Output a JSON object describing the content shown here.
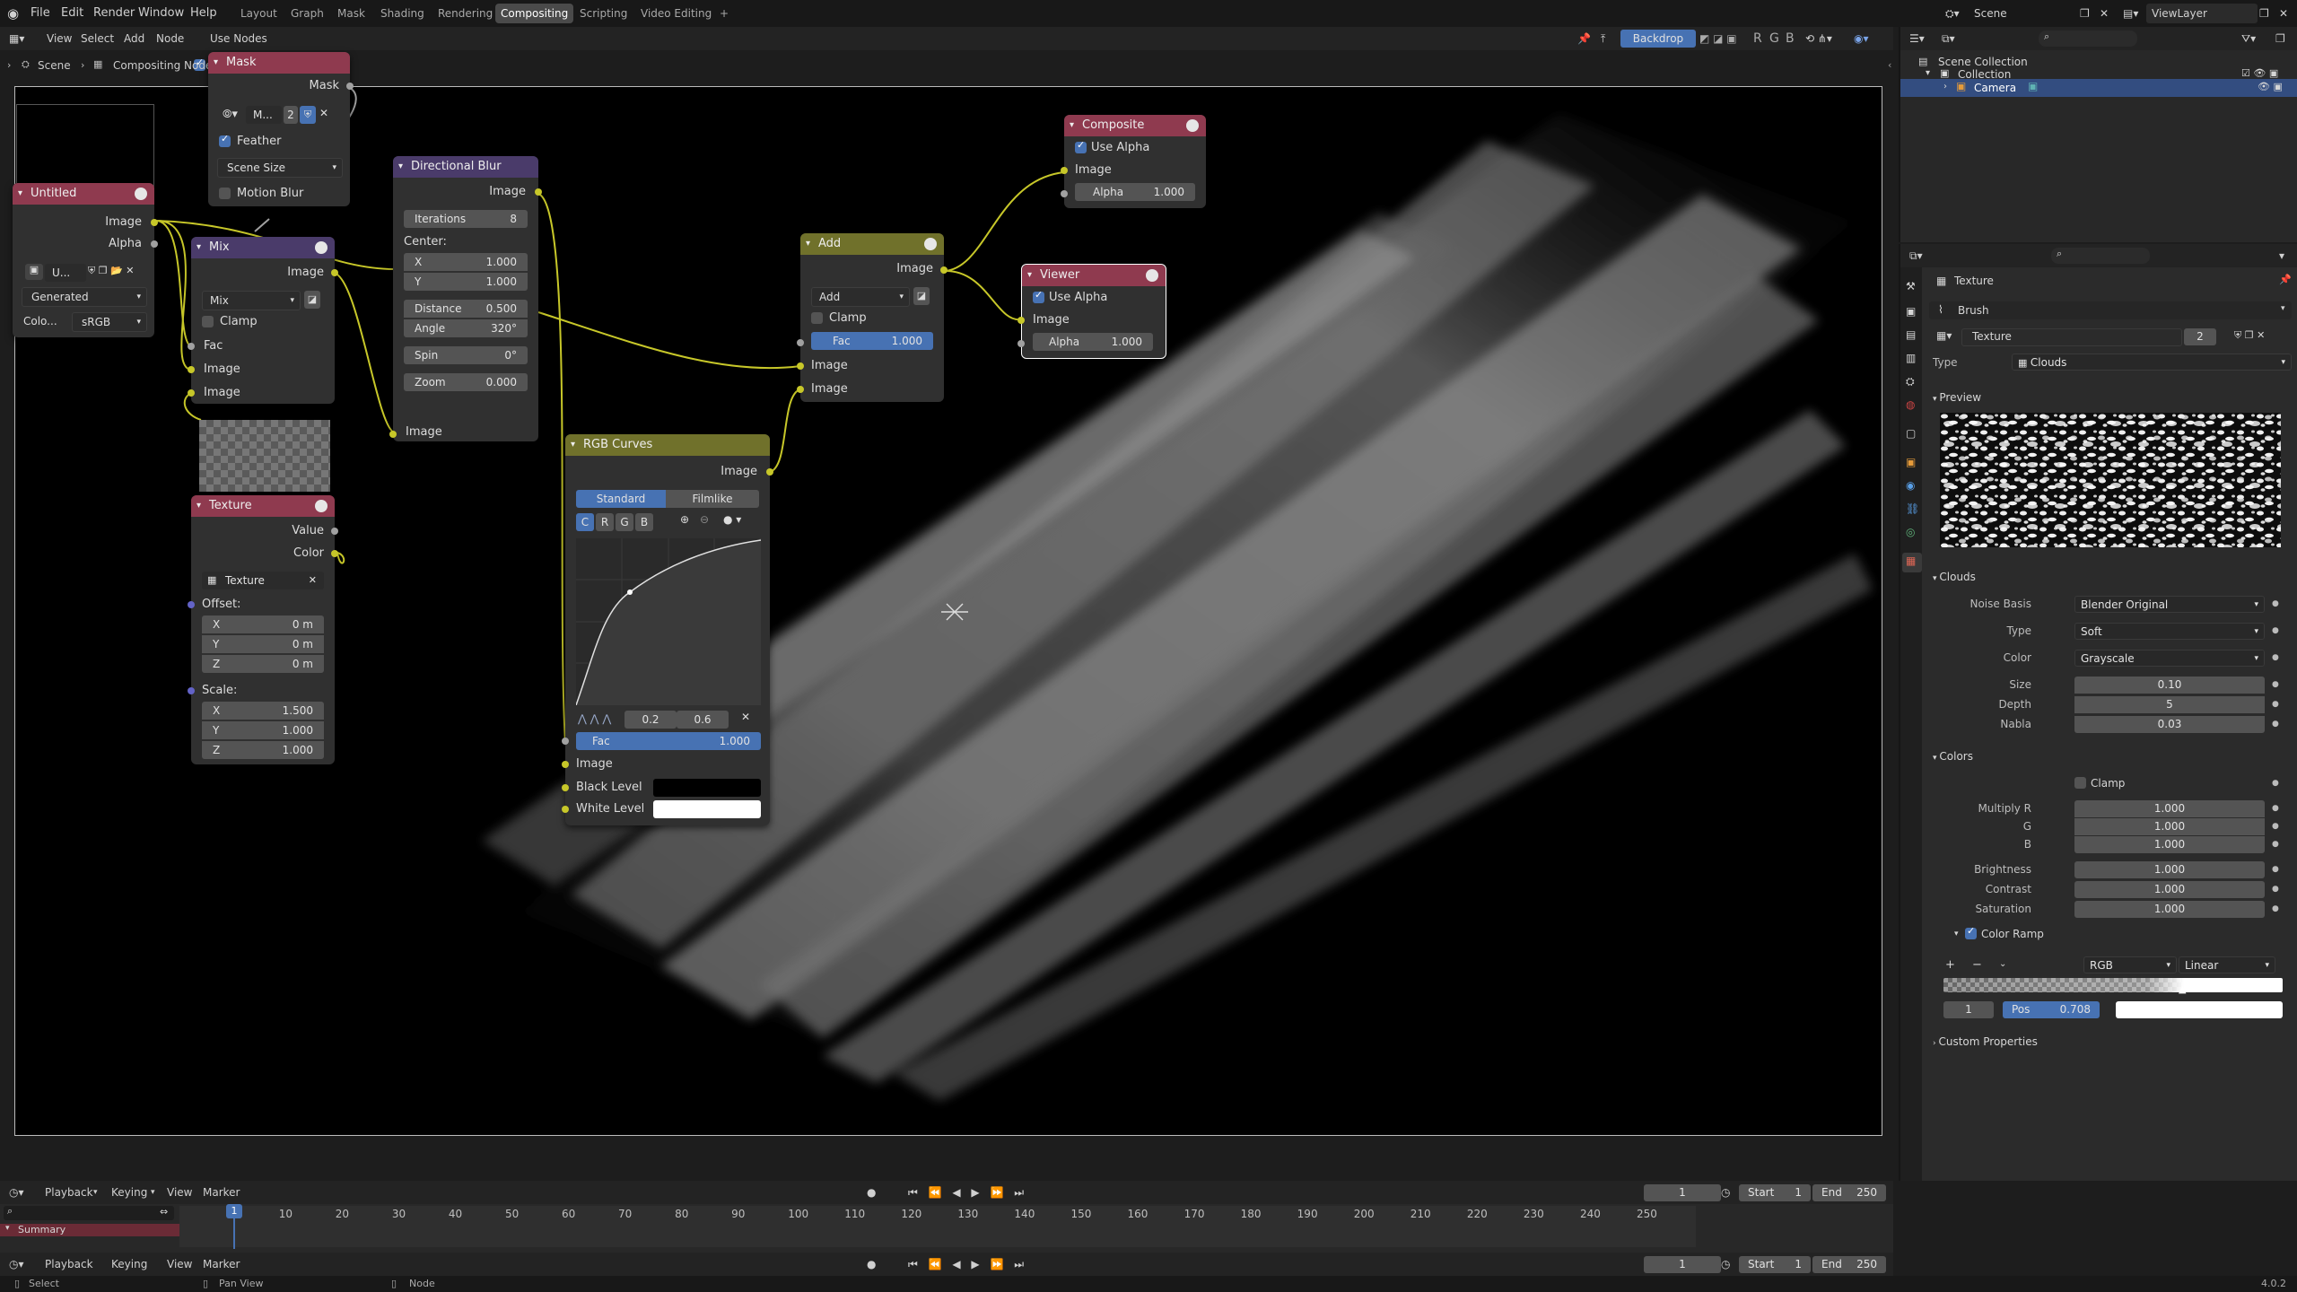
{
  "menu": {
    "items": [
      "File",
      "Edit",
      "Render",
      "Window",
      "Help"
    ],
    "workspaces": [
      "Layout",
      "Graph",
      "Mask",
      "Shading",
      "Rendering",
      "Compositing",
      "Scripting",
      "Video Editing"
    ],
    "add_tab": "+",
    "scene_label": "Scene",
    "view_layer_label": "ViewLayer"
  },
  "editor_header": {
    "menus": [
      "View",
      "Select",
      "Add",
      "Node"
    ],
    "use_nodes_label": "Use Nodes",
    "backdrop_label": "Backdrop",
    "backdrop_channels": [
      "R",
      "G",
      "B"
    ]
  },
  "breadcrumb": {
    "scene": "Scene",
    "tree": "Compositing Nodetree"
  },
  "nodes": {
    "mask": {
      "title": "Mask",
      "out_mask": "Mask",
      "datablock": "M...",
      "users": "2",
      "feather": "Feather",
      "size_mode": "Scene Size",
      "motion_blur": "Motion Blur"
    },
    "untitled": {
      "title": "Untitled",
      "out_image": "Image",
      "out_alpha": "Alpha",
      "datablock": "U...",
      "source": "Generated",
      "colorspace_label": "Colo...",
      "colorspace": "sRGB"
    },
    "mix": {
      "title": "Mix",
      "out_image": "Image",
      "blend": "Mix",
      "clamp": "Clamp",
      "in_fac": "Fac",
      "in_image1": "Image",
      "in_image2": "Image"
    },
    "dirblur": {
      "title": "Directional Blur",
      "out_image": "Image",
      "iterations_label": "Iterations",
      "iterations": "8",
      "center_label": "Center:",
      "x_label": "X",
      "x": "1.000",
      "y_label": "Y",
      "y": "1.000",
      "distance_label": "Distance",
      "distance": "0.500",
      "angle_label": "Angle",
      "angle": "320°",
      "spin_label": "Spin",
      "spin": "0°",
      "zoom_label": "Zoom",
      "zoom": "0.000",
      "in_image": "Image"
    },
    "texture": {
      "title": "Texture",
      "out_value": "Value",
      "out_color": "Color",
      "datablock": "Texture",
      "offset_label": "Offset:",
      "offset": [
        {
          "l": "X",
          "v": "0 m"
        },
        {
          "l": "Y",
          "v": "0 m"
        },
        {
          "l": "Z",
          "v": "0 m"
        }
      ],
      "scale_label": "Scale:",
      "scale": [
        {
          "l": "X",
          "v": "1.500"
        },
        {
          "l": "Y",
          "v": "1.000"
        },
        {
          "l": "Z",
          "v": "1.000"
        }
      ]
    },
    "add": {
      "title": "Add",
      "out_image": "Image",
      "blend": "Add",
      "clamp": "Clamp",
      "fac_label": "Fac",
      "fac": "1.000",
      "in_image1": "Image",
      "in_image2": "Image"
    },
    "composite": {
      "title": "Composite",
      "use_alpha": "Use Alpha",
      "in_image": "Image",
      "alpha_label": "Alpha",
      "alpha": "1.000"
    },
    "viewer": {
      "title": "Viewer",
      "use_alpha": "Use Alpha",
      "in_image": "Image",
      "alpha_label": "Alpha",
      "alpha": "1.000"
    },
    "curves": {
      "title": "RGB Curves",
      "out_image": "Image",
      "tab_standard": "Standard",
      "tab_filmlike": "Filmlike",
      "channels": [
        "C",
        "R",
        "G",
        "B"
      ],
      "pt_x": "0.2",
      "pt_y": "0.6",
      "fac_label": "Fac",
      "fac": "1.000",
      "in_image": "Image",
      "black_level": "Black Level",
      "white_level": "White Level"
    }
  },
  "outliner": {
    "title": "Scene Collection",
    "collection": "Collection",
    "camera": "Camera"
  },
  "properties": {
    "texture_label": "Texture",
    "brush_label": "Brush",
    "texture_name": "Texture",
    "users": "2",
    "type_label": "Type",
    "type_value": "Clouds",
    "preview_label": "Preview",
    "clouds_label": "Clouds",
    "noise_basis_label": "Noise Basis",
    "noise_basis": "Blender Original",
    "ctype_label": "Type",
    "ctype": "Soft",
    "color_label": "Color",
    "color": "Grayscale",
    "size_label": "Size",
    "size": "0.10",
    "depth_label": "Depth",
    "depth": "5",
    "nabla_label": "Nabla",
    "nabla": "0.03",
    "colors_label": "Colors",
    "clamp_label": "Clamp",
    "multiply_r_label": "Multiply R",
    "multiply_r": "1.000",
    "g_label": "G",
    "g": "1.000",
    "b_label": "B",
    "b": "1.000",
    "brightness_label": "Brightness",
    "brightness": "1.000",
    "contrast_label": "Contrast",
    "contrast": "1.000",
    "saturation_label": "Saturation",
    "saturation": "1.000",
    "color_ramp_label": "Color Ramp",
    "ramp_mode": "RGB",
    "ramp_interp": "Linear",
    "ramp_index": "1",
    "ramp_pos_label": "Pos",
    "ramp_pos": "0.708",
    "custom_props_label": "Custom Properties"
  },
  "timeline": {
    "menus": [
      "Playback",
      "Keying",
      "View",
      "Marker"
    ],
    "current_frame": "1",
    "start_label": "Start",
    "start": "1",
    "end_label": "End",
    "end": "250",
    "ticks": [
      "1",
      "10",
      "20",
      "30",
      "40",
      "50",
      "60",
      "70",
      "80",
      "90",
      "100",
      "110",
      "120",
      "130",
      "140",
      "150",
      "160",
      "170",
      "180",
      "190",
      "200",
      "210",
      "220",
      "230",
      "240",
      "250"
    ],
    "summary": "Summary"
  },
  "status_bar": {
    "select": "Select",
    "pan": "Pan View",
    "node": "Node",
    "version": "4.0.2"
  },
  "colors": {
    "accent": "#4772b3",
    "header_red": "#8f3a4f",
    "header_purple": "#4a3b6a",
    "header_olive": "#70712b",
    "socket_yellow": "#c7c729"
  }
}
